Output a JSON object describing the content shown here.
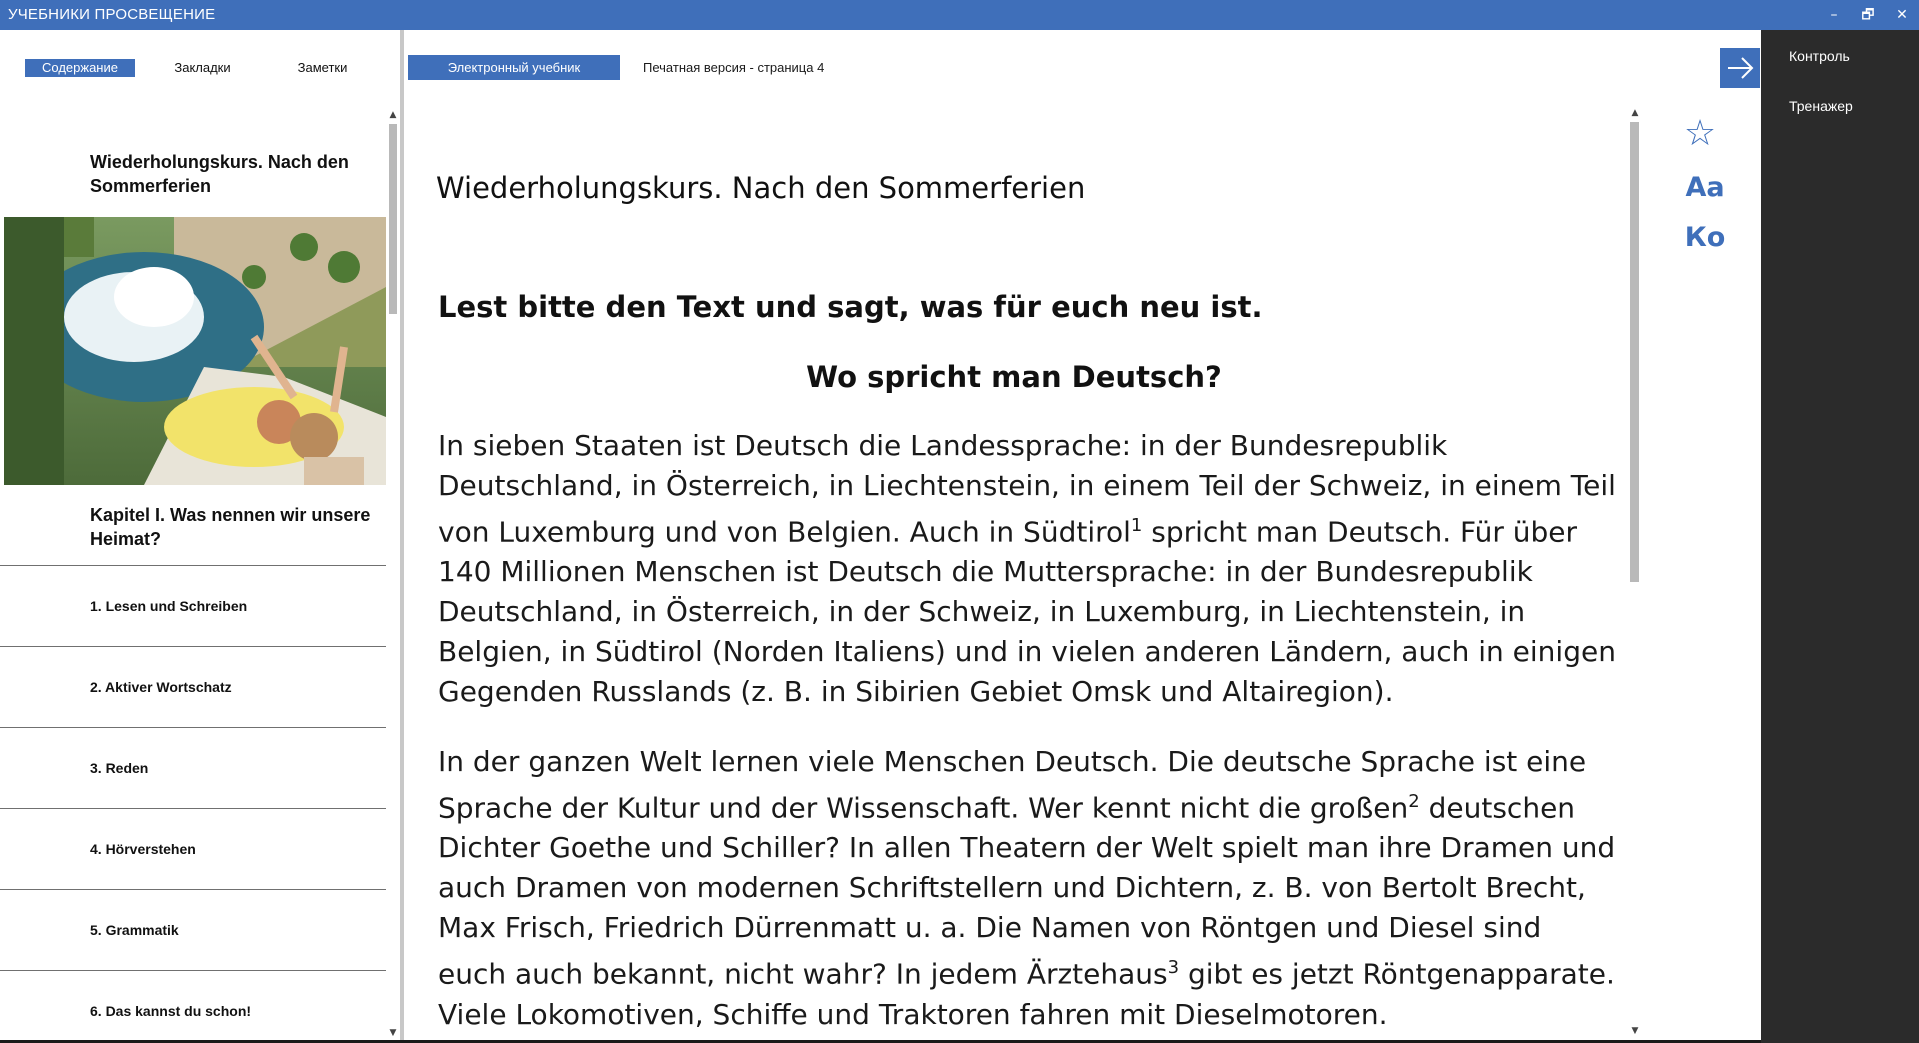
{
  "window": {
    "title": "УЧЕБНИКИ ПРОСВЕЩЕНИЕ",
    "controls": [
      "–",
      "🗗",
      "✕"
    ]
  },
  "left_panel": {
    "tabs": [
      {
        "label": "Содержание",
        "active": true
      },
      {
        "label": "Закладки",
        "active": false
      },
      {
        "label": "Заметки",
        "active": false
      }
    ],
    "section_top": "Wiederholungskurs. Nach den Sommerferien",
    "chapter": "Kapitel I. Was nennen wir unsere Heimat?",
    "items": [
      "1. Lesen und Schreiben",
      "2. Aktiver Wortschatz",
      "3. Reden",
      "4. Hörverstehen",
      "5. Grammatik",
      "6. Das kannst du schon!"
    ]
  },
  "header": {
    "tab_active": "Электронный учебник",
    "tab_print": "Печатная версия - страница 4"
  },
  "content": {
    "title": "Wiederholungskurs. Nach den Sommerferien",
    "task": "Lest bitte den Text und sagt, was für euch neu ist.",
    "subtitle": "Wo spricht man Deutsch?",
    "p1_a": "In sieben Staaten ist Deutsch die Landessprache: in der Bundesrepublik Deutschland, in Österreich, in Liechtenstein, in einem Teil der Schweiz, in einem Teil von Luxemburg und von Belgien. Auch in Südtirol",
    "p1_sup": "1",
    "p1_b": " spricht man Deutsch. Für über 140 Millionen Menschen ist Deutsch die Muttersprache: in der Bundesrepublik Deutschland, in Österreich, in der Schweiz, in Luxemburg, in Liechtenstein, in Belgien, in Südtirol (Norden Italiens) und in vielen anderen Ländern, auch in einigen Gegenden Russlands (z. B. in Sibirien Gebiet Omsk und Altairegion).",
    "p2_a": "In der ganzen Welt lernen viele Menschen Deutsch. Die deutsche Sprache ist eine Sprache der Kultur und der Wissenschaft. Wer kennt nicht die großen",
    "p2_sup1": "2",
    "p2_b": " deutschen Dichter Goethe und Schiller? In allen Theatern der Welt spielt man ihre Dramen und auch Dramen von modernen Schriftstellern und Dichtern, z. B. von Bertolt Brecht, Max Frisch, Friedrich Dürrenmatt u. a. Die Namen von Röntgen und Diesel sind euch auch bekannt, nicht wahr? In jedem Ärztehaus",
    "p2_sup2": "3",
    "p2_c": " gibt es jetzt Röntgenapparate. Viele Lokomotiven, Schiffe und Traktoren fahren mit Dieselmotoren."
  },
  "tools": {
    "star_icon": "☆",
    "font_label": "Aa",
    "ko_label": "Ко"
  },
  "right_panel": {
    "links": [
      "Контроль",
      "Тренажер"
    ]
  },
  "colors": {
    "accent": "#3f6fba",
    "dark_panel": "#2b2b2b"
  }
}
